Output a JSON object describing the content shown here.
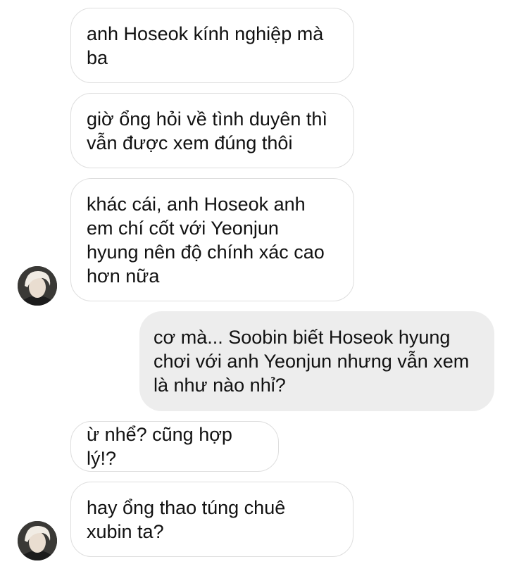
{
  "messages": [
    {
      "side": "incoming",
      "text": "anh Hoseok kính nghiệp mà\nba"
    },
    {
      "side": "incoming",
      "text": "giờ ổng hỏi về tình duyên thì\nvẫn được xem đúng thôi"
    },
    {
      "side": "incoming",
      "text": "khác cái, anh Hoseok anh\nem chí cốt với Yeonjun\nhyung nên độ chính xác cao\nhơn nữa",
      "avatar": "contact-avatar"
    },
    {
      "side": "outgoing",
      "text": "cơ mà... Soobin biết Hoseok hyung\nchơi với anh Yeonjun nhưng vẫn xem\nlà như nào nhỉ?"
    },
    {
      "side": "incoming",
      "text": "ừ nhể? cũng hợp lý!?"
    },
    {
      "side": "incoming",
      "text": "hay ổng thao túng chuê\nxubin ta?",
      "avatar": "contact-avatar"
    }
  ],
  "colors": {
    "incoming_bubble": "#ffffff",
    "incoming_border": "#dedede",
    "outgoing_bubble": "#ededed",
    "text": "#111111"
  }
}
